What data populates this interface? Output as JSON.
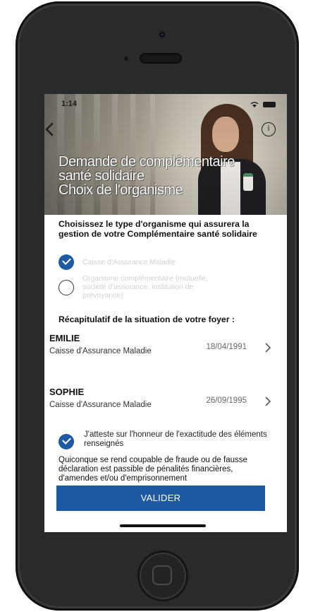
{
  "status_bar": {
    "time": "1:14",
    "signal": "...."
  },
  "header": {
    "title_lines": [
      "Demande de complémentaire",
      "santé solidaire",
      "Choix de l'organisme"
    ],
    "info_label": "i"
  },
  "question": "Choisissez le type d'organisme qui assurera la gestion de votre Complémentaire santé solidaire",
  "options": [
    {
      "label": "Caisse d'Assurance Maladie",
      "selected": true
    },
    {
      "label": "Organisme complémentaire (mutuelle, société d'assurance, institution de prévoyance)",
      "selected": false
    }
  ],
  "recap_title": "Récapitulatif de la situation de votre foyer :",
  "household": [
    {
      "name": "EMILIE",
      "organisme": "Caisse d'Assurance Maladie",
      "birthdate": "18/04/1991"
    },
    {
      "name": "SOPHIE",
      "organisme": "Caisse d'Assurance Maladie",
      "birthdate": "26/09/1995"
    }
  ],
  "attestation": {
    "text": "J'atteste sur l'honneur de l'exactitude des éléments renseignés",
    "checked": true
  },
  "legal_text": "Quiconque se rend coupable de fraude ou de fausse déclaration est passible de pénalités financières, d'amendes et/ou d'emprisonnement",
  "submit_label": "VALIDER",
  "colors": {
    "accent": "#1e5aa3",
    "phone_body": "#2a2a2c"
  }
}
